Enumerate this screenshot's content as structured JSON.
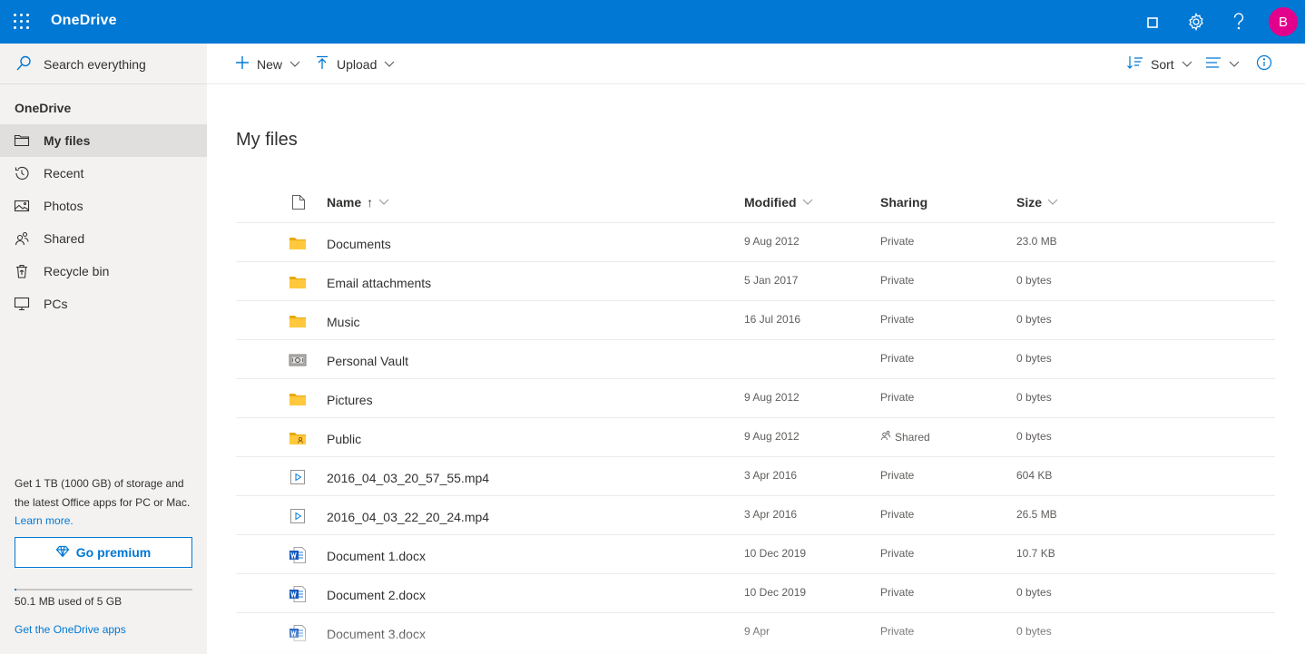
{
  "header": {
    "brand": "OneDrive",
    "avatar_initial": "B",
    "icons": [
      "app-launcher-icon",
      "square-icon",
      "gear-icon",
      "help-icon"
    ],
    "colors": {
      "bar": "#0078d4",
      "avatar": "#e3008c"
    }
  },
  "sidebar": {
    "search_label": "Search everything",
    "section_title": "OneDrive",
    "items": [
      {
        "label": "My files",
        "icon": "folder-icon",
        "active": true
      },
      {
        "label": "Recent",
        "icon": "history-icon",
        "active": false
      },
      {
        "label": "Photos",
        "icon": "photo-icon",
        "active": false
      },
      {
        "label": "Shared",
        "icon": "people-icon",
        "active": false
      },
      {
        "label": "Recycle bin",
        "icon": "recycle-bin-icon",
        "active": false
      },
      {
        "label": "PCs",
        "icon": "monitor-icon",
        "active": false
      }
    ],
    "promo_text": "Get 1 TB (1000 GB) of storage and the latest Office apps for PC or Mac.",
    "promo_link": "Learn more.",
    "premium_label": "Go premium",
    "quota_text": "50.1 MB used of 5 GB",
    "quota_fraction": 0.0098,
    "apps_link": "Get the OneDrive apps"
  },
  "toolbar": {
    "new_label": "New",
    "upload_label": "Upload",
    "sort_label": "Sort"
  },
  "main": {
    "title": "My files",
    "columns": {
      "name": "Name",
      "name_sort": "↑",
      "modified": "Modified",
      "sharing": "Sharing",
      "size": "Size"
    },
    "files": [
      {
        "name": "Documents",
        "type": "folder",
        "modified": "9 Aug 2012",
        "sharing": "Private",
        "size": "23.0 MB"
      },
      {
        "name": "Email attachments",
        "type": "folder",
        "modified": "5 Jan 2017",
        "sharing": "Private",
        "size": "0 bytes"
      },
      {
        "name": "Music",
        "type": "folder",
        "modified": "16 Jul 2016",
        "sharing": "Private",
        "size": "0 bytes"
      },
      {
        "name": "Personal Vault",
        "type": "vault",
        "modified": "",
        "sharing": "Private",
        "size": "0 bytes"
      },
      {
        "name": "Pictures",
        "type": "folder",
        "modified": "9 Aug 2012",
        "sharing": "Private",
        "size": "0 bytes"
      },
      {
        "name": "Public",
        "type": "shared-folder",
        "modified": "9 Aug 2012",
        "sharing": "Shared",
        "size": "0 bytes"
      },
      {
        "name": "2016_04_03_20_57_55.mp4",
        "type": "video",
        "modified": "3 Apr 2016",
        "sharing": "Private",
        "size": "604 KB"
      },
      {
        "name": "2016_04_03_22_20_24.mp4",
        "type": "video",
        "modified": "3 Apr 2016",
        "sharing": "Private",
        "size": "26.5 MB"
      },
      {
        "name": "Document 1.docx",
        "type": "word",
        "modified": "10 Dec 2019",
        "sharing": "Private",
        "size": "10.7 KB"
      },
      {
        "name": "Document 2.docx",
        "type": "word",
        "modified": "10 Dec 2019",
        "sharing": "Private",
        "size": "0 bytes"
      },
      {
        "name": "Document 3.docx",
        "type": "word",
        "modified": "9 Apr",
        "sharing": "Private",
        "size": "0 bytes"
      }
    ]
  }
}
